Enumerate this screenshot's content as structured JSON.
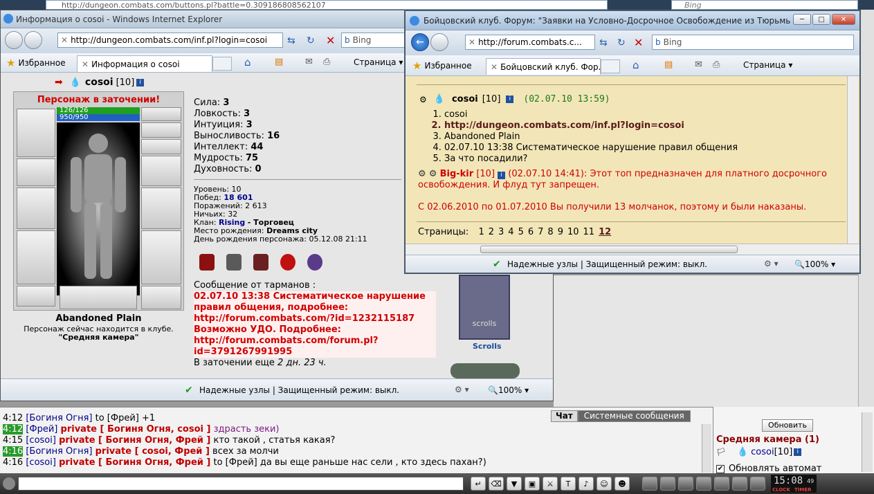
{
  "back_window": {
    "title_url": "http://dungeon.combats.com/buttons.pl?battle=0.309186808562107",
    "search": "Bing"
  },
  "main_window": {
    "title": "Информация о cosoi - Windows Internet Explorer",
    "url": "http://dungeon.combats.com/inf.pl?login=cosoi",
    "search": "Bing",
    "favorites": "Избранное",
    "tab": "Информация о cosoi",
    "page_menu": "Страница",
    "status": "Надежные узлы | Защищенный режим: выкл.",
    "zoom": "100%"
  },
  "character": {
    "name": "cosoi",
    "level": "[10]",
    "prison_banner": "Персонаж в заточении!",
    "hp": "126/126",
    "mana": "950/950",
    "location": "Abandoned Plain",
    "presence_line": "Персонаж сейчас находится в клубе.",
    "room": "\"Средняя камера\"",
    "stats": [
      {
        "label": "Сила:",
        "value": "3"
      },
      {
        "label": "Ловкость:",
        "value": "3"
      },
      {
        "label": "Интуиция:",
        "value": "3"
      },
      {
        "label": "Выносливость:",
        "value": "16"
      },
      {
        "label": "Интеллект:",
        "value": "44"
      },
      {
        "label": "Мудрость:",
        "value": "75"
      },
      {
        "label": "Духовность:",
        "value": "0"
      }
    ],
    "info": {
      "level_l": "Уровень:",
      "level_v": "10",
      "wins_l": "Побед:",
      "wins_v": "18 601",
      "losses_l": "Поражений:",
      "losses_v": "2 613",
      "draws_l": "Ничьих:",
      "draws_v": "32",
      "clan_l": "Клан:",
      "clan_v": "Rising",
      "clan_rest": "- Торговец",
      "birthplace_l": "Место рождения:",
      "birthplace_v": "Dreams city",
      "birthday": "День рождения персонажа: 05.12.08 21:11"
    },
    "message_header": "Сообщение от тарманов :",
    "message_lines": [
      "02.07.10 13:38 Систематическое нарушение",
      "правил общения, подробнее:",
      "http://forum.combats.com/?id=1232115187",
      "Возможно УДО. Подробнее:",
      "http://forum.combats.com/forum.pl?",
      "id=3791267991995"
    ],
    "prison_time_prefix": "В заточении еще",
    "prison_time": "2 дн. 23 ч.",
    "scrolls_label": "Scrolls",
    "scroll_text": "scrolls"
  },
  "forum_window": {
    "title": "Бойцовский клуб. Форум: \"Заявки на Условно-Досрочное Освобождение из Тюрьмы.\" - Wind...",
    "url": "http://forum.combats.c...",
    "search": "Bing",
    "favorites": "Избранное",
    "tab": "Бойцовский клуб. Фор...",
    "page_menu": "Страница",
    "post1": {
      "name": "cosoi",
      "level": "[10]",
      "time": "(02.07.10 13:59)",
      "items": [
        "cosoi",
        "http://dungeon.combats.com/inf.pl?login=cosoi",
        "Abandoned Plain",
        "02.07.10 13:38 Систематическое нарушение правил общения",
        "За что посадили?"
      ]
    },
    "post2": {
      "name": "Big-kir",
      "level": "[10]",
      "time_text": "(02.07.10 14:41): Этот топ предназначен для платного досрочного",
      "text2": "освобождения. И флуд тут запрещен.",
      "text3": "С 02.06.2010 по 01.07.2010 Вы получили 13 молчанок, поэтому и были наказаны."
    },
    "pages_label": "Страницы:",
    "pages": [
      "1",
      "2",
      "3",
      "4",
      "5",
      "6",
      "7",
      "8",
      "9",
      "10",
      "11",
      "12"
    ],
    "status": "Надежные узлы | Защищенный режим: выкл.",
    "zoom": "100%"
  },
  "chat": {
    "tab_chat": "Чат",
    "tab_system": "Системные сообщения",
    "lines": [
      {
        "time": "4:12",
        "nick": "[Богиня Огня]",
        "priv": "",
        "text": "to [Фрей] +1"
      },
      {
        "time": "4:12",
        "nick": "[Фрей]",
        "priv": "private [ Богиня Огня, cosoi ]",
        "text": "здрасть зеки)"
      },
      {
        "time": "4:15",
        "nick": "[cosoi]",
        "priv": "private [ Богиня Огня, Фрей ]",
        "text": "кто такой , статья какая?"
      },
      {
        "time": "4:16",
        "nick": "[Богиня Огня]",
        "priv": "private [ cosoi, Фрей ]",
        "text": "всех за молчи"
      },
      {
        "time": "4:16",
        "nick": "[cosoi]",
        "priv": "private [ Богиня Огня, Фрей ]",
        "text": "to [Фрей] да вы еще раньше нас сели , кто здесь пахан?)"
      }
    ],
    "refresh": "Обновить",
    "room": "Средняя камера (1)",
    "member": "cosoi",
    "member_level": "[10]",
    "auto_refresh": "Обновлять автомат",
    "clock": "15:08",
    "clock_small": "49",
    "clock_label": "CLOCK",
    "timer_label": "TIMER"
  }
}
